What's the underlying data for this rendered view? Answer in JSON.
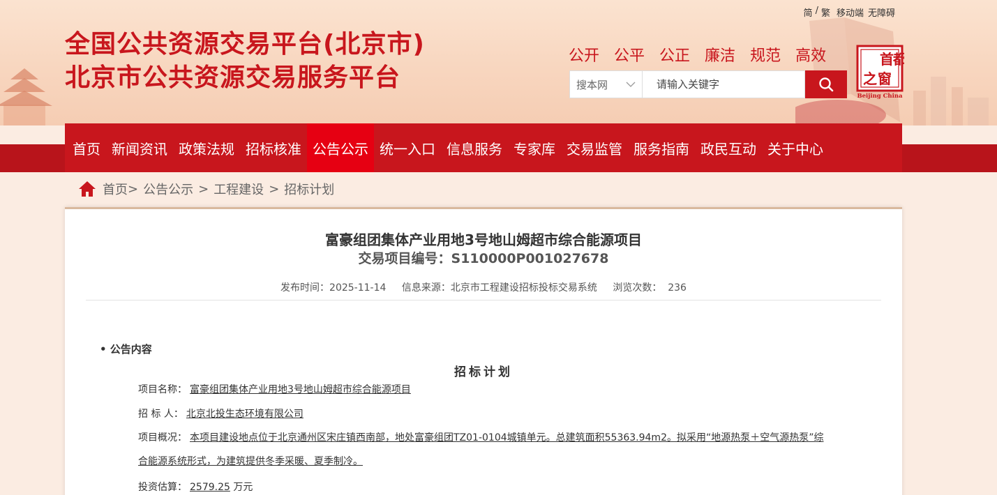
{
  "util": {
    "simplified": "简",
    "slash": "/",
    "traditional": "繁",
    "mobile": "移动端",
    "accessible": "无障碍"
  },
  "site": {
    "title_line1": "全国公共资源交易平台(北京市)",
    "title_line2": "北京市公共资源交易服务平台"
  },
  "slogans": [
    "公开",
    "公平",
    "公正",
    "廉洁",
    "规范",
    "高效"
  ],
  "search": {
    "scope": "搜本网",
    "placeholder": "请输入关键字"
  },
  "logo": {
    "chars": [
      "首",
      "都",
      "之",
      "窗"
    ],
    "caption": "Beijing China"
  },
  "nav": {
    "items": [
      "首页",
      "新闻资讯",
      "政策法规",
      "招标核准",
      "公告公示",
      "统一入口",
      "信息服务",
      "专家库",
      "交易监管",
      "服务指南",
      "政民互动",
      "关于中心"
    ],
    "active": "公告公示"
  },
  "breadcrumb": {
    "home": "首页",
    "items": [
      "公告公示",
      "工程建设",
      "招标计划"
    ]
  },
  "article": {
    "title": "富豪组团集体产业用地3号地山姆超市综合能源项目",
    "code": "交易项目编号：S110000P001027678",
    "publish_time": "发布时间：2025-11-14",
    "source": "信息来源：北京市工程建设招标投标交易系统",
    "views": "浏览次数：  236"
  },
  "notice": {
    "section_label": "• 公告内容",
    "plan_title": "招标计划",
    "project_name_label": "项目名称：",
    "project_name": "富豪组团集体产业用地3号地山姆超市综合能源项目",
    "tenderer_label": "招 标 人：",
    "tenderer": "北京北投生态环境有限公司",
    "overview_label": "项目概况：",
    "overview": "本项目建设地点位于北京通州区宋庄镇西南部，地处富豪组团TZ01-0104城镇单元。总建筑面积55363.94m2。拟采用“地源热泵＋空气源热泵”综合能源系统形式，为建筑提供冬季采暖、夏季制冷。",
    "investment_label": "投资估算：",
    "investment": "2579.25",
    "investment_unit": "万元"
  }
}
